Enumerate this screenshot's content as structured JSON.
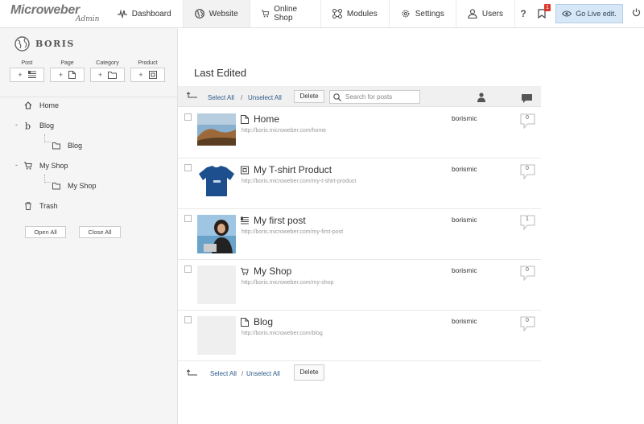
{
  "brand": {
    "name": "Microweber",
    "sub": "Admin"
  },
  "nav": [
    {
      "label": "Dashboard",
      "icon": "pulse-icon"
    },
    {
      "label": "Website",
      "icon": "globe-icon",
      "active": true
    },
    {
      "label": "Online Shop",
      "icon": "cart-icon"
    },
    {
      "label": "Modules",
      "icon": "modules-icon"
    },
    {
      "label": "Settings",
      "icon": "gear-icon"
    },
    {
      "label": "Users",
      "icon": "user-icon"
    }
  ],
  "topright": {
    "help": "?",
    "badge": "1",
    "golive": "Go Live edit."
  },
  "site": {
    "name": "BORIS"
  },
  "add_buttons": [
    {
      "label": "Post",
      "plus": "+"
    },
    {
      "label": "Page",
      "plus": "+"
    },
    {
      "label": "Category",
      "plus": "+"
    },
    {
      "label": "Product",
      "plus": "+"
    }
  ],
  "tree": {
    "collapse": "-",
    "items": [
      {
        "label": "Home"
      },
      {
        "label": "Blog"
      },
      {
        "label": "Blog"
      },
      {
        "label": "My Shop"
      },
      {
        "label": "My Shop"
      },
      {
        "label": "Trash"
      }
    ],
    "open_all": "Open All",
    "close_all": "Close All"
  },
  "main": {
    "heading": "Last Edited",
    "select_all": "Select All",
    "sep": "/",
    "unselect_all": "Unselect All",
    "delete": "Delete",
    "search_placeholder": "Search for posts"
  },
  "posts": [
    {
      "title": "Home",
      "url": "http://boris.microweber.com/home",
      "author": "borismic",
      "comments": "0",
      "type": "page"
    },
    {
      "title": "My T-shirt Product",
      "url": "http://boris.microweber.com/my-t-shirt-product",
      "author": "borismic",
      "comments": "0",
      "type": "product"
    },
    {
      "title": "My first post",
      "url": "http://boris.microweber.com/my-first-post",
      "author": "borismic",
      "comments": "1",
      "type": "post"
    },
    {
      "title": "My Shop",
      "url": "http://boris.microweber.com/my-shop",
      "author": "borismic",
      "comments": "0",
      "type": "shop"
    },
    {
      "title": "Blog",
      "url": "http://boris.microweber.com/blog",
      "author": "borismic",
      "comments": "0",
      "type": "page"
    }
  ],
  "footer": {
    "select_all": "Select All",
    "sep": "/",
    "unselect_all": "Unselect All",
    "delete": "Delete"
  }
}
